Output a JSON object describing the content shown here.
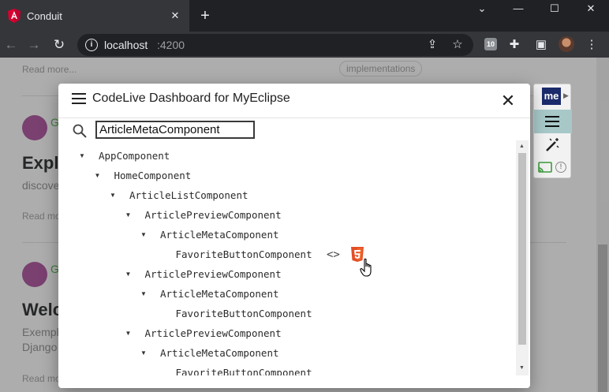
{
  "browser": {
    "tab_title": "Conduit",
    "tab_close": "✕",
    "new_tab": "+",
    "url_host": "localhost",
    "url_port": ":4200",
    "extension_badge": "10",
    "window_controls": [
      "⌄",
      "—",
      "☐",
      "✕"
    ]
  },
  "page": {
    "read_more": "Read more...",
    "tag_label": "implementations",
    "article_1_author": "G",
    "article_1_title": "Explo",
    "article_1_desc": "discove",
    "article_2_author": "G",
    "article_2_title": "Welc",
    "article_2_desc_line1": "Exempl",
    "article_2_desc_line2": "Django"
  },
  "side_panel": {
    "logo": "me"
  },
  "dialog": {
    "title": "CodeLive Dashboard for MyEclipse",
    "close": "✕",
    "search_value": "ArticleMetaComponent",
    "tree": [
      {
        "label": "AppComponent",
        "expanded": true
      },
      {
        "label": "HomeComponent",
        "expanded": true
      },
      {
        "label": "ArticleListComponent",
        "expanded": true
      },
      {
        "label": "ArticlePreviewComponent",
        "expanded": true
      },
      {
        "label": "ArticleMetaComponent",
        "expanded": true
      },
      {
        "label": "FavoriteButtonComponent",
        "expanded": false
      },
      {
        "label": "ArticlePreviewComponent",
        "expanded": true
      },
      {
        "label": "ArticleMetaComponent",
        "expanded": true
      },
      {
        "label": "FavoriteButtonComponent",
        "expanded": false
      },
      {
        "label": "ArticlePreviewComponent",
        "expanded": true
      },
      {
        "label": "ArticleMetaComponent",
        "expanded": true
      },
      {
        "label": "FavoriteButtonComponent",
        "expanded": false
      }
    ],
    "code_icon_glyph": "<>"
  },
  "colors": {
    "titlebar": "#202124",
    "tab_active": "#35363a",
    "html5_orange": "#e44d26",
    "angular_red": "#dd0031",
    "panel_highlight": "#a8c8c8",
    "me_logo": "#1b2a6b"
  }
}
